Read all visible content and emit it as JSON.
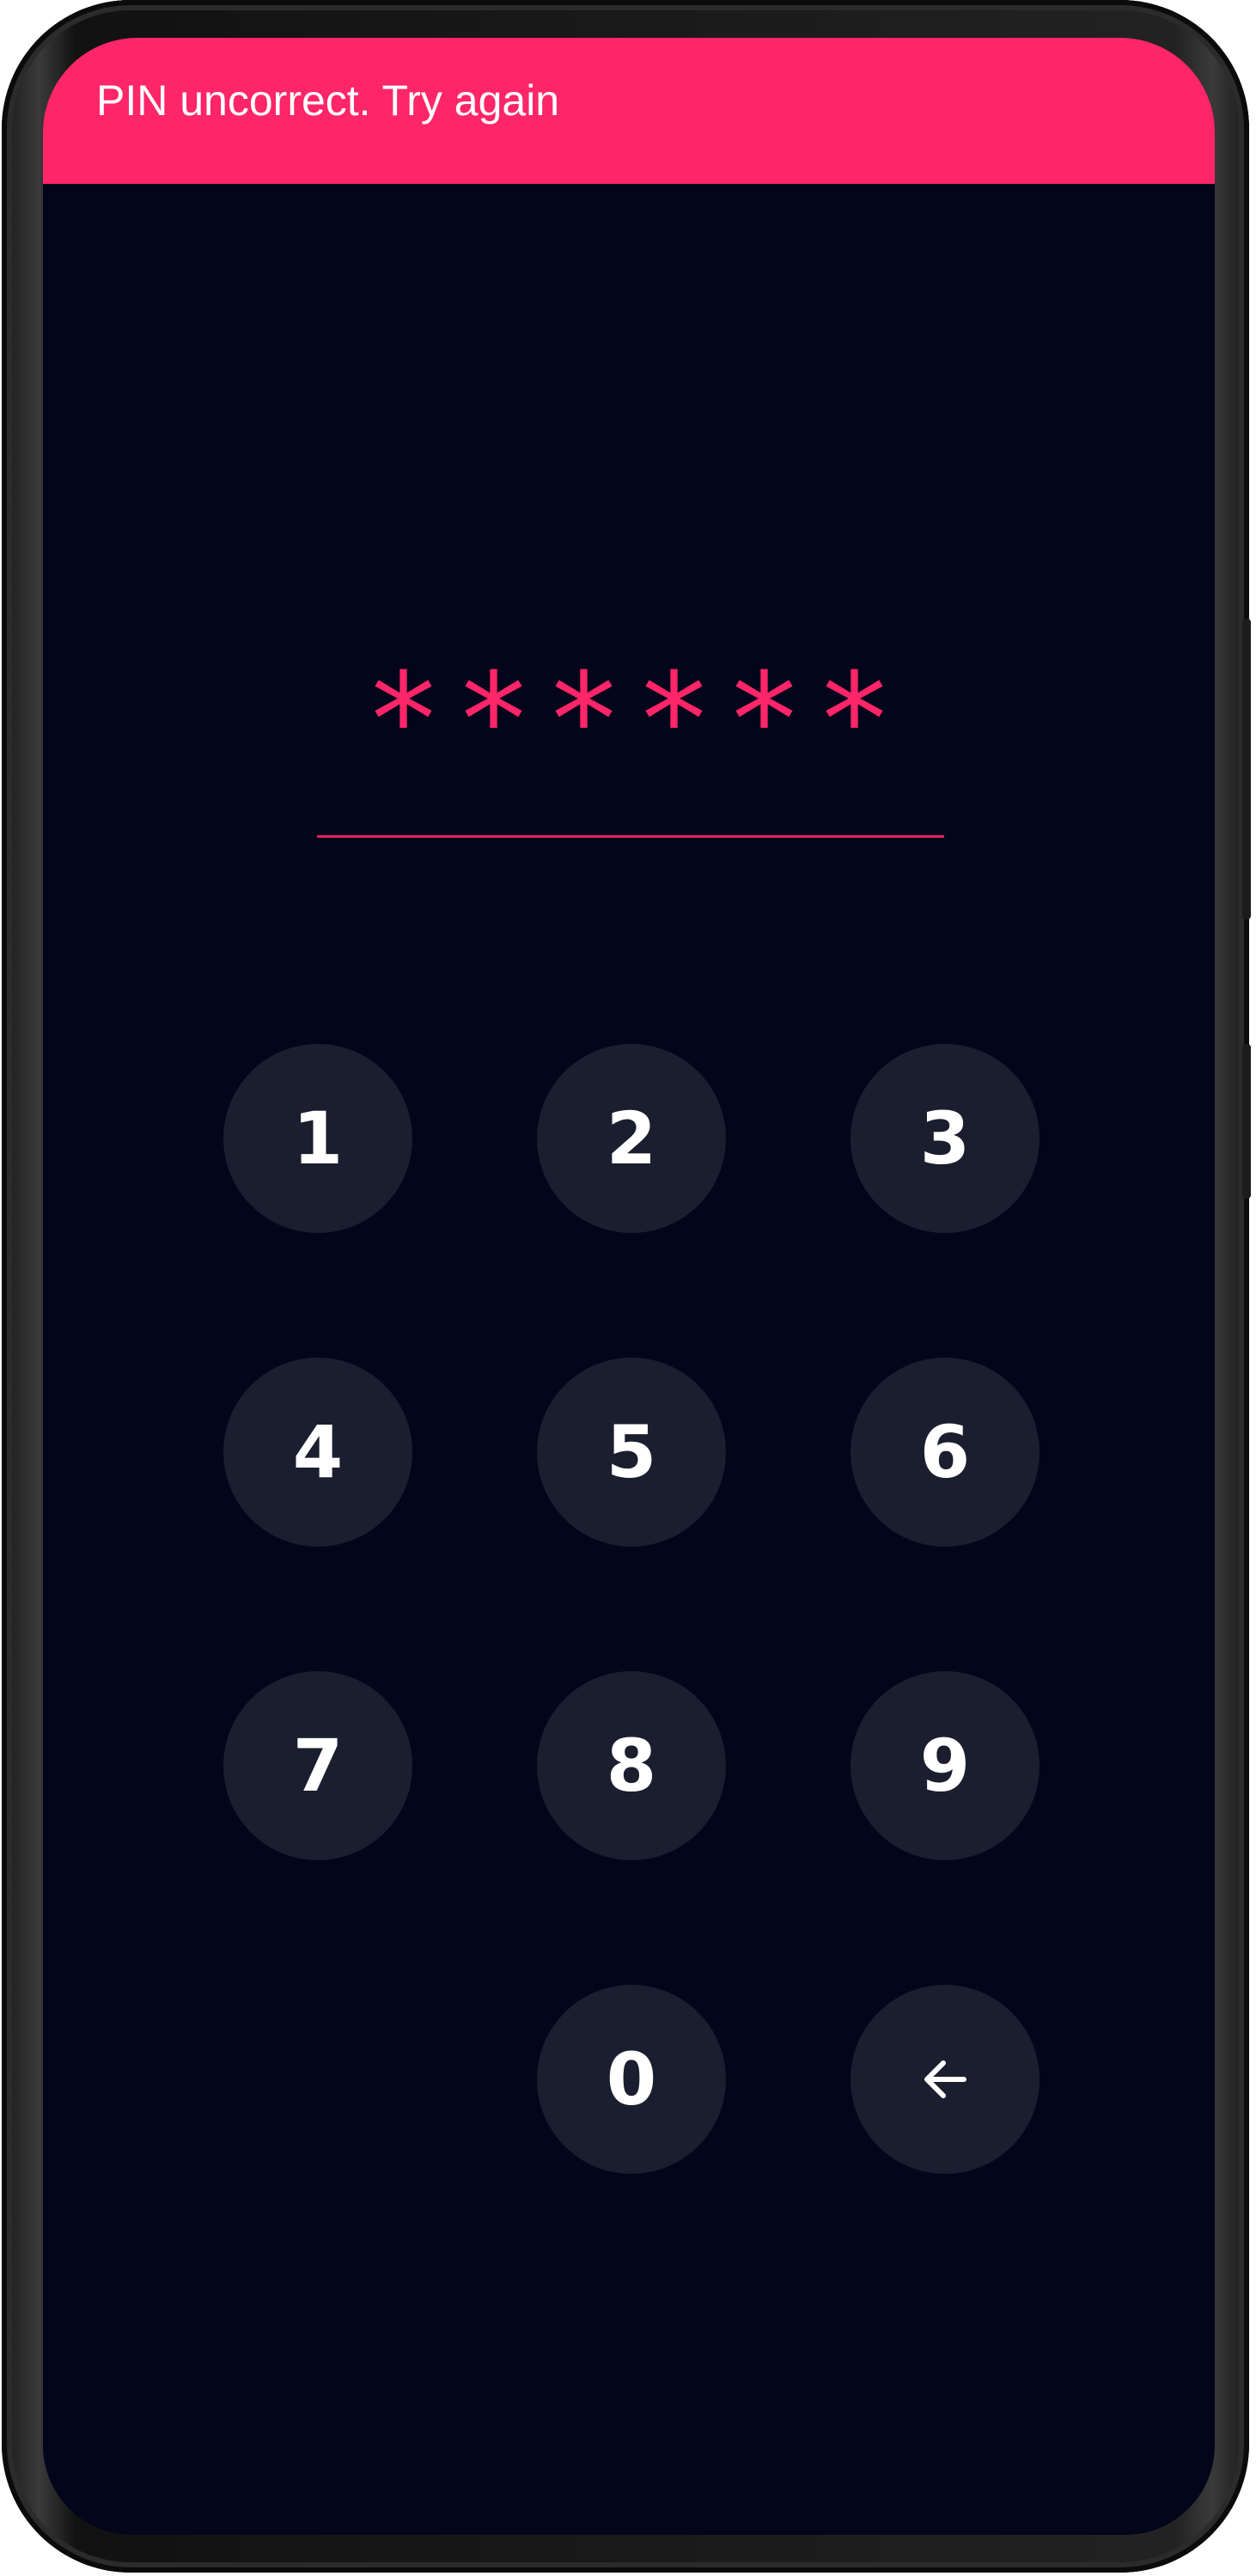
{
  "snackbar": {
    "message": "PIN uncorrect. Try again",
    "background_color": "#ff2569"
  },
  "pin": {
    "masked_value": "******",
    "digit_count": 6,
    "accent_color": "#ff2569"
  },
  "keypad": {
    "keys": {
      "k1": "1",
      "k2": "2",
      "k3": "3",
      "k4": "4",
      "k5": "5",
      "k6": "6",
      "k7": "7",
      "k8": "8",
      "k9": "9",
      "k0": "0"
    },
    "backspace_icon": "arrow-left-icon",
    "key_color": "#1b1e2e",
    "screen_background": "#03051a"
  }
}
